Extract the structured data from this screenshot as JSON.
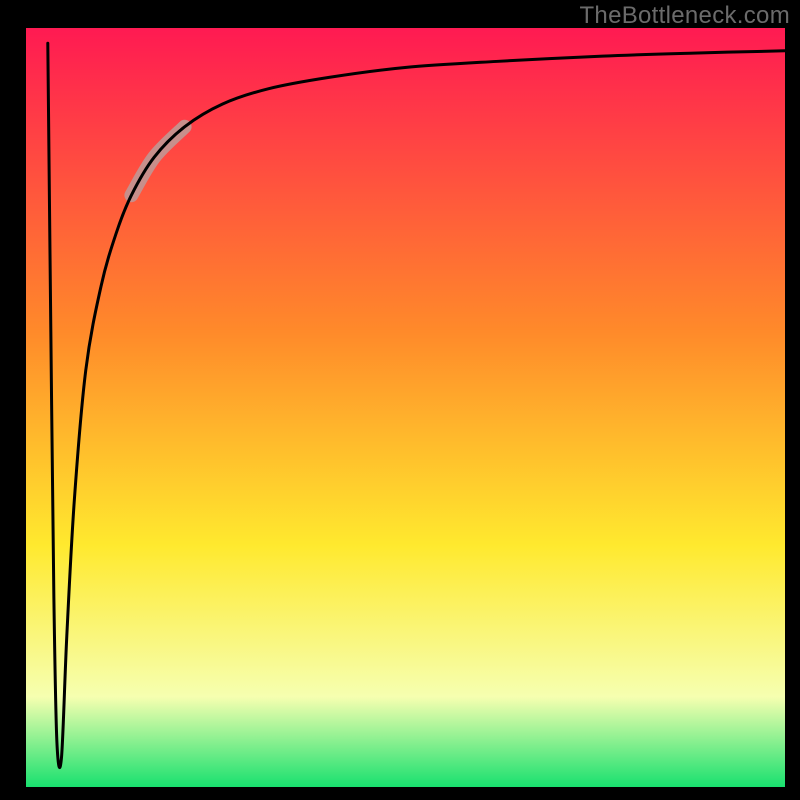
{
  "watermark": "TheBottleneck.com",
  "chart_data": {
    "type": "line",
    "title": "",
    "xlabel": "",
    "ylabel": "",
    "xlim": [
      0,
      100
    ],
    "ylim": [
      0,
      100
    ],
    "grid": false,
    "legend": false,
    "background_gradient": {
      "top": "#ff1a52",
      "mid1": "#ff8a2a",
      "mid2": "#ffe92e",
      "mid3": "#f6ffb0",
      "bottom": "#16e06e"
    },
    "series": [
      {
        "name": "bottleneck-curve",
        "x": [
          3.0,
          3.4,
          3.8,
          4.2,
          4.8,
          5.5,
          6.5,
          8.0,
          10.0,
          12.0,
          14.0,
          17.0,
          21.0,
          26.0,
          32.0,
          40.0,
          50.0,
          62.0,
          76.0,
          88.0,
          100.0
        ],
        "y": [
          98.0,
          60.0,
          25.0,
          6.0,
          4.0,
          20.0,
          38.0,
          55.0,
          66.0,
          73.0,
          78.0,
          83.0,
          87.0,
          90.0,
          92.0,
          93.5,
          94.8,
          95.6,
          96.3,
          96.7,
          97.0
        ]
      }
    ],
    "highlight_segment": {
      "x": [
        14.0,
        17.0,
        21.0
      ],
      "y": [
        78.0,
        83.0,
        87.0
      ],
      "color": "#c78f8b",
      "width": 14
    }
  }
}
